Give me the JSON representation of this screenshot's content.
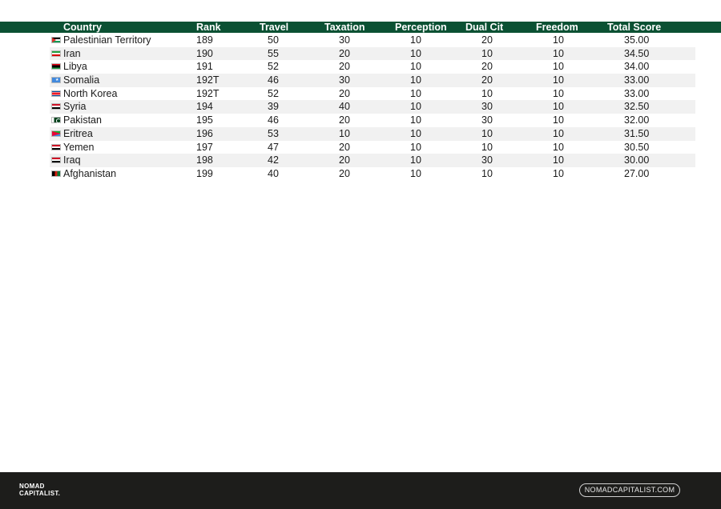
{
  "header": {
    "country": "Country",
    "rank": "Rank",
    "travel": "Travel",
    "taxation": "Taxation",
    "perception": "Perception",
    "dual_cit": "Dual Cit",
    "freedom": "Freedom",
    "total_score": "Total Score"
  },
  "rows": [
    {
      "country": "Palestinian Territory",
      "rank": "189",
      "travel": "50",
      "taxation": "30",
      "perception": "10",
      "dual_cit": "20",
      "freedom": "10",
      "total": "35.00",
      "flag_icon": "palestine-flag-icon"
    },
    {
      "country": "Iran",
      "rank": "190",
      "travel": "55",
      "taxation": "20",
      "perception": "10",
      "dual_cit": "10",
      "freedom": "10",
      "total": "34.50",
      "flag_icon": "iran-flag-icon"
    },
    {
      "country": "Libya",
      "rank": "191",
      "travel": "52",
      "taxation": "20",
      "perception": "10",
      "dual_cit": "20",
      "freedom": "10",
      "total": "34.00",
      "flag_icon": "libya-flag-icon"
    },
    {
      "country": "Somalia",
      "rank": "192T",
      "travel": "46",
      "taxation": "30",
      "perception": "10",
      "dual_cit": "20",
      "freedom": "10",
      "total": "33.00",
      "flag_icon": "somalia-flag-icon"
    },
    {
      "country": "North Korea",
      "rank": "192T",
      "travel": "52",
      "taxation": "20",
      "perception": "10",
      "dual_cit": "10",
      "freedom": "10",
      "total": "33.00",
      "flag_icon": "north-korea-flag-icon"
    },
    {
      "country": "Syria",
      "rank": "194",
      "travel": "39",
      "taxation": "40",
      "perception": "10",
      "dual_cit": "30",
      "freedom": "10",
      "total": "32.50",
      "flag_icon": "syria-flag-icon"
    },
    {
      "country": "Pakistan",
      "rank": "195",
      "travel": "46",
      "taxation": "20",
      "perception": "10",
      "dual_cit": "30",
      "freedom": "10",
      "total": "32.00",
      "flag_icon": "pakistan-flag-icon"
    },
    {
      "country": "Eritrea",
      "rank": "196",
      "travel": "53",
      "taxation": "10",
      "perception": "10",
      "dual_cit": "10",
      "freedom": "10",
      "total": "31.50",
      "flag_icon": "eritrea-flag-icon"
    },
    {
      "country": "Yemen",
      "rank": "197",
      "travel": "47",
      "taxation": "20",
      "perception": "10",
      "dual_cit": "10",
      "freedom": "10",
      "total": "30.50",
      "flag_icon": "yemen-flag-icon"
    },
    {
      "country": "Iraq",
      "rank": "198",
      "travel": "42",
      "taxation": "20",
      "perception": "10",
      "dual_cit": "30",
      "freedom": "10",
      "total": "30.00",
      "flag_icon": "iraq-flag-icon"
    },
    {
      "country": "Afghanistan",
      "rank": "199",
      "travel": "40",
      "taxation": "20",
      "perception": "10",
      "dual_cit": "10",
      "freedom": "10",
      "total": "27.00",
      "flag_icon": "afghanistan-flag-icon"
    }
  ],
  "footer": {
    "logo_line1": "NOMAD",
    "logo_line2": "CAPITALIST.",
    "website": "NOMADCAPITALIST.COM"
  },
  "colors": {
    "header_green": "#0b5133",
    "footer_dark": "#1d1d1b",
    "row_alt": "#f1f1f1"
  }
}
